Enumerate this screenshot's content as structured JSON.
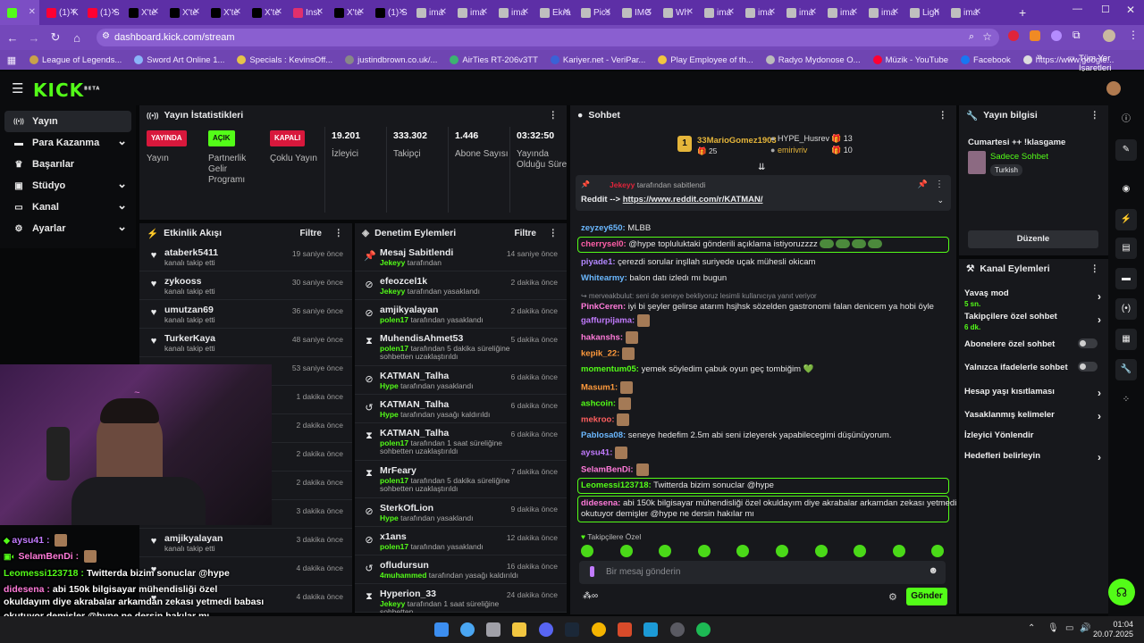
{
  "browser": {
    "tabs": [
      {
        "label": "",
        "fav": "#53fc18"
      },
      {
        "label": "(1) K",
        "fav": "#ff0033"
      },
      {
        "label": "(1) S",
        "fav": "#ff0033"
      },
      {
        "label": "X'te",
        "fav": "#000000"
      },
      {
        "label": "X'te",
        "fav": "#000000"
      },
      {
        "label": "X'te",
        "fav": "#000000"
      },
      {
        "label": "X'te",
        "fav": "#000000"
      },
      {
        "label": "Inst",
        "fav": "#e1306c"
      },
      {
        "label": "X'te",
        "fav": "#000000"
      },
      {
        "label": "(1) S",
        "fav": "#000000"
      },
      {
        "label": "ima",
        "fav": "#bfbfbf"
      },
      {
        "label": "ima",
        "fav": "#bfbfbf"
      },
      {
        "label": "ima",
        "fav": "#bfbfbf"
      },
      {
        "label": "Ekra",
        "fav": "#bfbfbf"
      },
      {
        "label": "Pics",
        "fav": "#bfbfbf"
      },
      {
        "label": "IMG",
        "fav": "#bfbfbf"
      },
      {
        "label": "Wh",
        "fav": "#bfbfbf"
      },
      {
        "label": "ima",
        "fav": "#bfbfbf"
      },
      {
        "label": "ima",
        "fav": "#bfbfbf"
      },
      {
        "label": "ima",
        "fav": "#bfbfbf"
      },
      {
        "label": "ima",
        "fav": "#bfbfbf"
      },
      {
        "label": "ima",
        "fav": "#bfbfbf"
      },
      {
        "label": "Ligh",
        "fav": "#bfbfbf"
      },
      {
        "label": "ima",
        "fav": "#bfbfbf"
      }
    ],
    "url": "dashboard.kick.com/stream",
    "bookmarks": [
      "League of Legends...",
      "Sword Art Online 1...",
      "Specials : KevinsOff...",
      "justindbrown.co.uk/...",
      "AirTies RT-206v3TT",
      "Kariyer.net - VeriPar...",
      "Play Employee of th...",
      "Radyo Mydonose O...",
      "Müzik - YouTube",
      "Facebook",
      "https://www.google..."
    ],
    "bookmarks_all": "Tüm Yer İşaretleri"
  },
  "kick": {
    "logo": "KICK",
    "beta": "BETA",
    "colors": {
      "accent": "#53fc18",
      "panel": "#17181c",
      "bg": "#070809",
      "live_red": "#d8183c"
    }
  },
  "sidebar": [
    {
      "label": "Yayın",
      "icon": "broadcast-icon",
      "active": true,
      "chev": false
    },
    {
      "label": "Para Kazanma",
      "icon": "money-icon",
      "active": false,
      "chev": true
    },
    {
      "label": "Başarılar",
      "icon": "trophy-icon",
      "active": false,
      "chev": false
    },
    {
      "label": "Stüdyo",
      "icon": "studio-icon",
      "active": false,
      "chev": true
    },
    {
      "label": "Kanal",
      "icon": "channel-icon",
      "active": false,
      "chev": true
    },
    {
      "label": "Ayarlar",
      "icon": "gear-icon",
      "active": false,
      "chev": true
    }
  ],
  "stats": {
    "title": "Yayın İstatistikleri",
    "badges": [
      {
        "badge": "YAYINDA",
        "label": "Yayın",
        "color": "#d8183c"
      },
      {
        "badge": "AÇIK",
        "label": "Partnerlik Gelir Programı",
        "color": "#53fc18"
      },
      {
        "badge": "KAPALI",
        "label": "Çoklu Yayın",
        "color": "#d8183c"
      }
    ],
    "values": [
      {
        "value": "19.201",
        "label": "İzleyici"
      },
      {
        "value": "333.302",
        "label": "Takipçi"
      },
      {
        "value": "1.446",
        "label": "Abone Sayısı"
      },
      {
        "value": "03:32:50",
        "label": "Yayında Olduğu Süre"
      }
    ]
  },
  "activity": {
    "title": "Etkinlik Akışı",
    "filter": "Filtre",
    "items": [
      {
        "name": "ataberk5411",
        "sub": "kanalı takip etti",
        "time": "19 saniye önce"
      },
      {
        "name": "zykooss",
        "sub": "kanalı takip etti",
        "time": "30 saniye önce"
      },
      {
        "name": "umutzan69",
        "sub": "kanalı takip etti",
        "time": "36 saniye önce"
      },
      {
        "name": "TurkerKaya",
        "sub": "kanalı takip etti",
        "time": "48 saniye önce"
      },
      {
        "name": "",
        "sub": "",
        "time": "53 saniye önce"
      },
      {
        "name": "",
        "sub": "",
        "time": "1 dakika önce"
      },
      {
        "name": "",
        "sub": "",
        "time": "2 dakika önce"
      },
      {
        "name": "",
        "sub": "",
        "time": "2 dakika önce"
      },
      {
        "name": "",
        "sub": "",
        "time": "2 dakika önce"
      },
      {
        "name": "",
        "sub": "kanalı takip etti",
        "time": "3 dakika önce"
      },
      {
        "name": "amjikyalayan",
        "sub": "kanalı takip etti",
        "time": "3 dakika önce"
      },
      {
        "name": "",
        "sub": "",
        "time": "4 dakika önce"
      },
      {
        "name": "",
        "sub": "",
        "time": "4 dakika önce"
      }
    ]
  },
  "moderation": {
    "title": "Denetim Eylemleri",
    "filter": "Filtre",
    "items": [
      {
        "icon": "pin-icon",
        "glyph": "📌",
        "name": "Mesaj Sabitlendi",
        "by": "Jekeyy",
        "sub": " tarafından",
        "time": "14 saniye önce"
      },
      {
        "icon": "ban-icon",
        "glyph": "⊘",
        "name": "efeozcel1k",
        "by": "Jekeyy",
        "sub": " tarafından yasaklandı",
        "time": "2 dakika önce"
      },
      {
        "icon": "ban-icon",
        "glyph": "⊘",
        "name": "amjikyalayan",
        "by": "polen17",
        "sub": " tarafından yasaklandı",
        "time": "2 dakika önce"
      },
      {
        "icon": "timeout-icon",
        "glyph": "⧗",
        "name": "MuhendisAhmet53",
        "by": "polen17",
        "sub": " tarafından 5 dakika süreliğine sohbetten uzaklaştırıldı",
        "time": "5 dakika önce"
      },
      {
        "icon": "ban-icon",
        "glyph": "⊘",
        "name": "KATMAN_Talha",
        "by": "Hype",
        "sub": " tarafından yasaklandı",
        "time": "6 dakika önce"
      },
      {
        "icon": "unban-icon",
        "glyph": "↺",
        "name": "KATMAN_Talha",
        "by": "Hype",
        "sub": " tarafından yasağı kaldırıldı",
        "time": "6 dakika önce"
      },
      {
        "icon": "timeout-icon",
        "glyph": "⧗",
        "name": "KATMAN_Talha",
        "by": "polen17",
        "sub": " tarafından 1 saat süreliğine sohbetten uzaklaştırıldı",
        "time": "6 dakika önce"
      },
      {
        "icon": "timeout-icon",
        "glyph": "⧗",
        "name": "MrFeary",
        "by": "polen17",
        "sub": " tarafından 5 dakika süreliğine sohbetten uzaklaştırıldı",
        "time": "7 dakika önce"
      },
      {
        "icon": "ban-icon",
        "glyph": "⊘",
        "name": "SterkOfLion",
        "by": "Hype",
        "sub": " tarafından yasaklandı",
        "time": "9 dakika önce"
      },
      {
        "icon": "ban-icon",
        "glyph": "⊘",
        "name": "x1ans",
        "by": "polen17",
        "sub": " tarafından yasaklandı",
        "time": "12 dakika önce"
      },
      {
        "icon": "unban-icon",
        "glyph": "↺",
        "name": "ofludursun",
        "by": "4muhammed",
        "sub": " tarafından yasağı kaldırıldı",
        "time": "16 dakika önce"
      },
      {
        "icon": "timeout-icon",
        "glyph": "⧗",
        "name": "Hyperion_33",
        "by": "Jekeyy",
        "sub": " tarafından 1 saat süreliğine sohbetten",
        "time": "24 dakika önce"
      }
    ]
  },
  "chat": {
    "title": "Sohbet",
    "top_gifter": {
      "rank": "1",
      "name": "33MarioGomez1903",
      "count": "25"
    },
    "gifters": [
      {
        "name": "HYPE_Husrev",
        "count": "13"
      },
      {
        "name": "emirivriv",
        "count": "10"
      }
    ],
    "pinned": {
      "by": "Jekeyy",
      "by_suffix": " tarafından sabitlendi",
      "text": "Reddit --> ",
      "link": "https://www.reddit.com/r/KATMAN/"
    },
    "messages": [
      {
        "user": "zeyzey650:",
        "color": "#6bb8ff",
        "text": " MLBB",
        "hl": false
      },
      {
        "user": "cherrysel0:",
        "color": "#ff5fa8",
        "text": " @hype topluluktaki gönderili açıklama istiyoruzzzz",
        "hl": true,
        "pepe": true
      },
      {
        "user": "piyade1:",
        "color": "#b388ff",
        "text": " çerezdi sorular inşllah suriyede uçak mühesli okicam",
        "hl": false
      },
      {
        "user": "Whitearmy:",
        "color": "#6bb8ff",
        "text": " balon datı izledı mı bugun",
        "hl": false
      },
      {
        "user": "",
        "color": "#999",
        "text": "↪ merveakbulut: seni de seneye bekliyoruz lesimli kullanıcıya yanıt veriyor",
        "hl": false,
        "reply": true
      },
      {
        "user": "PinkCeren:",
        "color": "#ff7ad9",
        "text": " iyi bi şeyler gelirse atarım hsjhsk sözelden gastronomi falan denicem ya hobi öyle",
        "hl": false
      },
      {
        "user": "gaffurpijama:",
        "color": "#c27bff",
        "text": "",
        "hl": false,
        "emo": true
      },
      {
        "user": "hakanshs:",
        "color": "#ff7ad9",
        "text": "",
        "hl": false,
        "emo": true
      },
      {
        "user": "kepik_22:",
        "color": "#ff9a3c",
        "text": "",
        "hl": false,
        "emo": true
      },
      {
        "user": "momentum05:",
        "color": "#53fc18",
        "text": " yemek söyledim çabuk oyun geç tombiğim 💚",
        "hl": false
      },
      {
        "user": "Masum1:",
        "color": "#ff9a3c",
        "text": "",
        "hl": false,
        "emo": true
      },
      {
        "user": "ashcoin:",
        "color": "#53fc18",
        "text": "",
        "hl": false,
        "emo": true
      },
      {
        "user": "mekroo:",
        "color": "#ff5f5f",
        "text": "",
        "hl": false,
        "emo": true
      },
      {
        "user": "Pablosa08:",
        "color": "#6bb8ff",
        "text": " seneye hedefim 2.5m abi seni izleyerek yapabilecegimi düşünüyorum.",
        "hl": false
      },
      {
        "user": "aysu41:",
        "color": "#c27bff",
        "text": "",
        "hl": false,
        "emo": true
      },
      {
        "user": "SelamBenDi:",
        "color": "#ff7ad9",
        "text": "",
        "hl": false,
        "emo": true
      },
      {
        "user": "Leomessi123718:",
        "color": "#53fc18",
        "text": " Twitterda bizim sonuclar @hype",
        "hl": true
      },
      {
        "user": "didesena:",
        "color": "#ff7ad9",
        "text": " abi 150k bilgisayar mühendisliği özel okuldayım diye akrabalar arkamdan zekası yetmedi babası",
        "text2": "okutuyor demişler @hype ne dersin hakılar mı",
        "hl": true
      }
    ],
    "followers_only": "Takipçilere Özel",
    "input_placeholder": "Bir mesaj gönderin",
    "send": "Gönder"
  },
  "stream_info": {
    "title": "Yayın bilgisi",
    "stream_title": "Cumartesi ++ !klasgame",
    "category": "Sadece Sohbet",
    "language": "Turkish",
    "edit": "Düzenle"
  },
  "channel_actions": {
    "title": "Kanal Eylemleri",
    "items": [
      {
        "label": "Yavaş mod",
        "sub": "5 sn.",
        "type": "arrow"
      },
      {
        "label": "Takipçilere özel sohbet",
        "sub": "6 dk.",
        "type": "arrow"
      },
      {
        "label": "Abonelere özel sohbet",
        "sub": "",
        "type": "toggle"
      },
      {
        "label": "Yalnızca ifadelerle sohbet",
        "sub": "",
        "type": "toggle"
      },
      {
        "label": "Hesap yaşı kısıtlaması",
        "sub": "",
        "type": "arrow"
      },
      {
        "label": "Yasaklanmış kelimeler",
        "sub": "",
        "type": "arrow"
      },
      {
        "label": "İzleyici Yönlendir",
        "sub": "",
        "type": "none"
      },
      {
        "label": "Hedefleri belirleyin",
        "sub": "",
        "type": "arrow"
      }
    ]
  },
  "overlay_chat": [
    {
      "user": "aysu41 :",
      "color": "#c27bff",
      "text": ""
    },
    {
      "user": "SelamBenDi :",
      "color": "#ff7ad9",
      "text": ""
    },
    {
      "user": "Leomessi123718 :",
      "color": "#53fc18",
      "text": " Twitterda bizim sonuclar @hype"
    },
    {
      "user": "didesena :",
      "color": "#ff7ad9",
      "text": " abi 150k bilgisayar mühendisliği özel"
    },
    {
      "user": "",
      "color": "#fff",
      "text": "okuldayım diye akrabalar arkamdan zekası yetmedi babası"
    },
    {
      "user": "",
      "color": "#fff",
      "text": "okutuyor demişler @hype ne dersin hakılar mı"
    }
  ],
  "taskbar": {
    "time": "01:04",
    "date": "20.07.2025"
  }
}
